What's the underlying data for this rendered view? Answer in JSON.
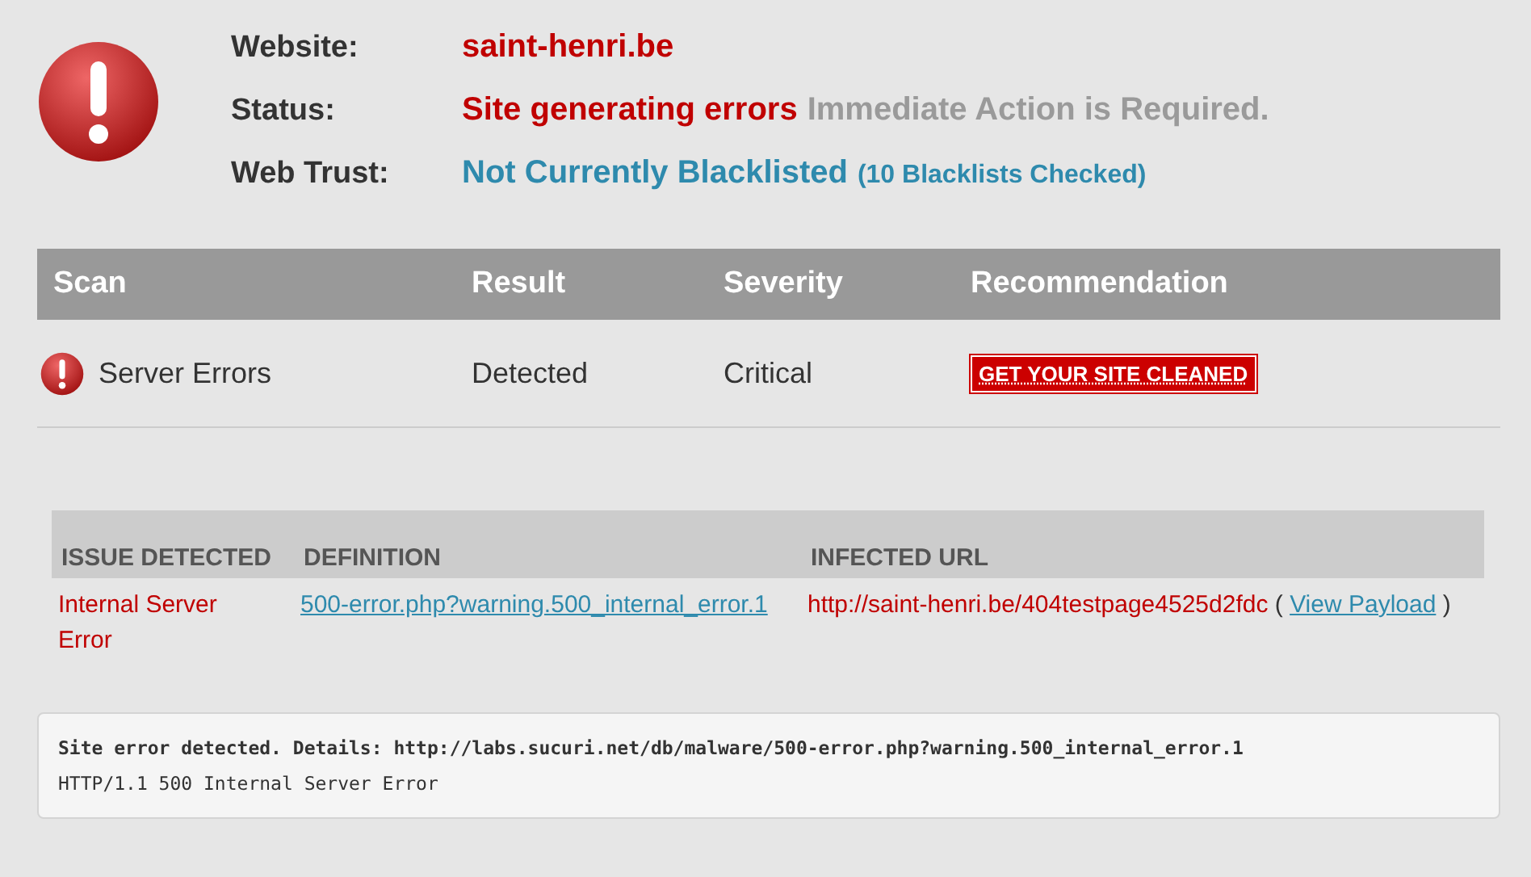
{
  "summary": [
    {
      "label": "Website:",
      "values": [
        {
          "text": "saint-henri.be",
          "color": "#c00000",
          "kind": "main"
        }
      ]
    },
    {
      "label": "Status:",
      "values": [
        {
          "text": "Site generating errors",
          "color": "#c00000",
          "kind": "main"
        },
        {
          "text": "Immediate Action is Required.",
          "color": "#9a9a9a",
          "kind": "main"
        }
      ]
    },
    {
      "label": "Web Trust:",
      "values": [
        {
          "text": "Not Currently Blacklisted",
          "color": "#2e8aad",
          "kind": "main"
        },
        {
          "text": "(10 Blacklists Checked)",
          "color": "#2e8aad",
          "kind": "note"
        }
      ]
    }
  ],
  "scan_table": {
    "columns": [
      "Scan",
      "Result",
      "Severity",
      "Recommendation"
    ],
    "rows": [
      {
        "kind": "error",
        "scan": "Server Errors",
        "result": "Detected",
        "severity": "Critical",
        "recommendation": "GET YOUR SITE CLEANED"
      }
    ]
  },
  "issues_table": {
    "columns": [
      "ISSUE DETECTED",
      "DEFINITION",
      "INFECTED URL"
    ],
    "rows": [
      {
        "issue": "Internal Server Error",
        "definition": "500-error.php?warning.500_internal_error.1",
        "infected_url": "http://saint-henri.be/404testpage4525d2fdc",
        "open": "(",
        "payload_link": "View Payload",
        "close": ")"
      }
    ]
  },
  "details": [
    {
      "text": "Site error detected. Details: http://labs.sucuri.net/db/malware/500-error.php?warning.500_internal_error.1",
      "bold": true
    },
    {
      "text": "HTTP/1.1 500 Internal Server Error",
      "bold": false
    }
  ]
}
